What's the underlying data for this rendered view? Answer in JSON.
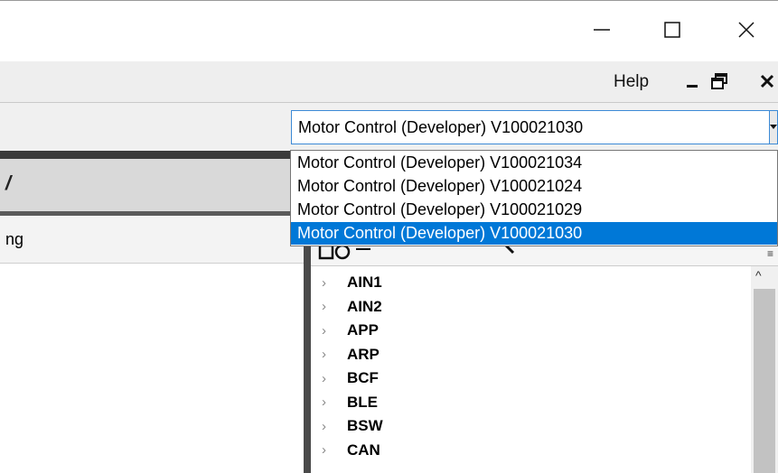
{
  "window": {
    "minimize_icon": "minimize-icon",
    "maximize_icon": "maximize-icon",
    "close_icon": "close-icon"
  },
  "menubar": {
    "help_label": "Help"
  },
  "version_combo": {
    "selected": "Motor Control (Developer) V100021030",
    "options": [
      "Motor Control (Developer) V100021034",
      "Motor Control (Developer) V100021024",
      "Motor Control (Developer) V100021029",
      "Motor Control (Developer) V100021030"
    ],
    "highlighted_index": 3
  },
  "left_pane": {
    "header_fragment": "/",
    "tab_fragment": "ng"
  },
  "tree": {
    "items": [
      "AIN1",
      "AIN2",
      "APP",
      "ARP",
      "BCF",
      "BLE",
      "BSW",
      "CAN"
    ]
  },
  "colors": {
    "selection": "#0078d7",
    "combo_border": "#3c8ad6"
  }
}
